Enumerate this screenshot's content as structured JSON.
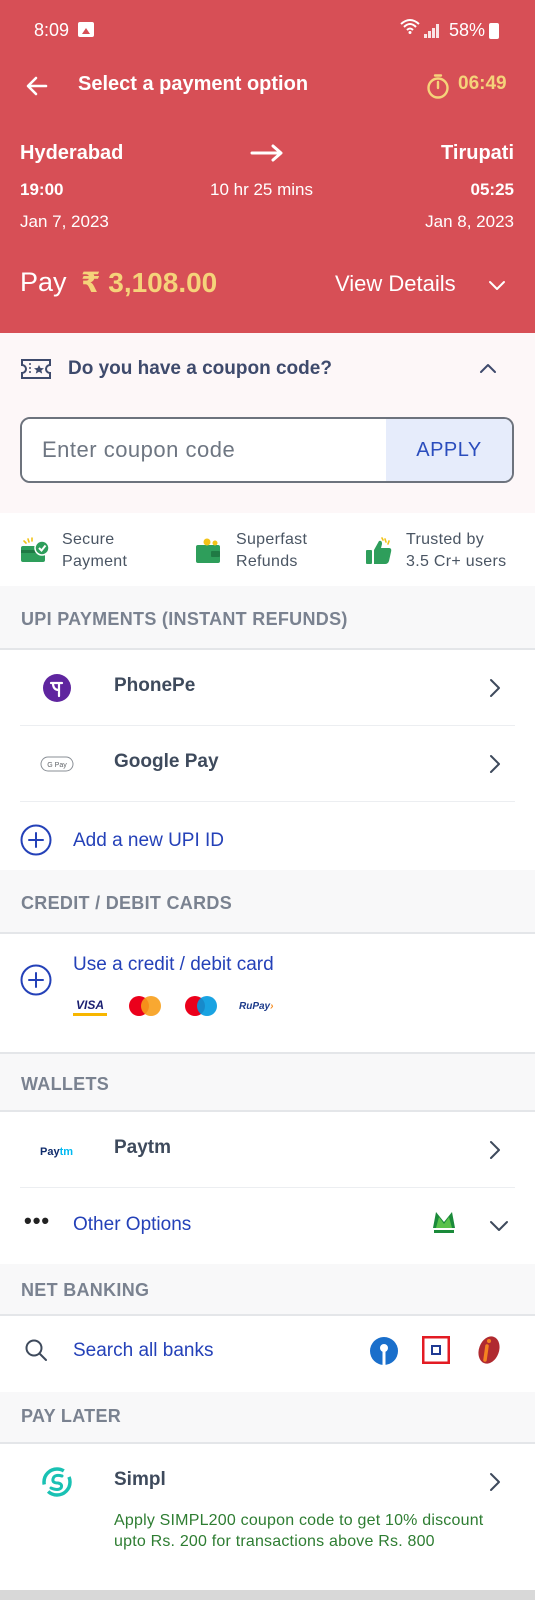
{
  "status_bar": {
    "time": "8:09",
    "battery": "58%"
  },
  "header": {
    "title": "Select a payment option",
    "timer": "06:49"
  },
  "journey": {
    "from_city": "Hyderabad",
    "to_city": "Tirupati",
    "departure_time": "19:00",
    "arrival_time": "05:25",
    "duration": "10 hr 25 mins",
    "departure_date": "Jan 7, 2023",
    "arrival_date": "Jan 8, 2023"
  },
  "payment": {
    "pay_label": "Pay",
    "amount": "₹ 3,108.00",
    "view_details": "View Details"
  },
  "coupon": {
    "question": "Do you have a coupon code?",
    "placeholder": "Enter coupon code",
    "apply_label": "APPLY"
  },
  "trust_badges": [
    {
      "line1": "Secure",
      "line2": "Payment"
    },
    {
      "line1": "Superfast",
      "line2": "Refunds"
    },
    {
      "line1": "Trusted by",
      "line2": "3.5 Cr+ users"
    }
  ],
  "sections": {
    "upi": "UPI PAYMENTS  (INSTANT REFUNDS)",
    "cards": "CREDIT / DEBIT CARDS",
    "wallets": "WALLETS",
    "net_banking": "NET BANKING",
    "pay_later": "PAY LATER"
  },
  "upi_options": [
    {
      "label": "PhonePe",
      "icon": "phonepe-icon"
    },
    {
      "label": "Google Pay",
      "icon": "google-pay-icon"
    }
  ],
  "upi_add": "Add a new UPI ID",
  "cards": {
    "use_card": "Use a credit / debit card",
    "brands": [
      "VISA",
      "Mastercard",
      "Maestro",
      "RuPay"
    ]
  },
  "wallets": {
    "paytm": "Paytm",
    "other": "Other Options"
  },
  "net_banking": {
    "search": "Search all banks"
  },
  "pay_later": {
    "simpl": "Simpl",
    "offer": "Apply SIMPL200 coupon code to get 10% discount upto Rs. 200 for transactions above Rs. 800"
  },
  "colors": {
    "header_bg": "#d74f56",
    "accent_yellow": "#f5d37a",
    "link_blue": "#2441b8",
    "offer_green": "#2e7d32"
  }
}
